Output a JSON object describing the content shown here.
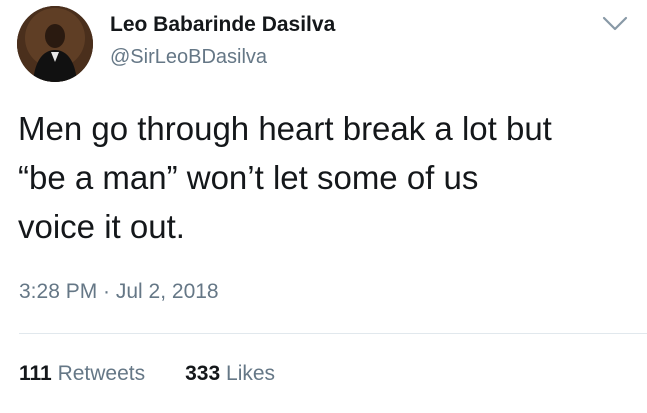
{
  "tweet": {
    "display_name": "Leo Babarinde Dasilva",
    "handle": "@SirLeoBDasilva",
    "text_lines": [
      "Men go through heart break a lot but",
      "“be a man” won’t let some of us",
      "voice it out."
    ],
    "timestamp": "3:28 PM · Jul 2, 2018",
    "retweets": {
      "count": "111",
      "label": "Retweets"
    },
    "likes": {
      "count": "333",
      "label": "Likes"
    }
  },
  "icons": {
    "menu": "chevron-down-icon"
  },
  "colors": {
    "text_primary": "#14171a",
    "text_secondary": "#657786",
    "divider": "#e1e8ed",
    "chevron": "#8899a6"
  }
}
